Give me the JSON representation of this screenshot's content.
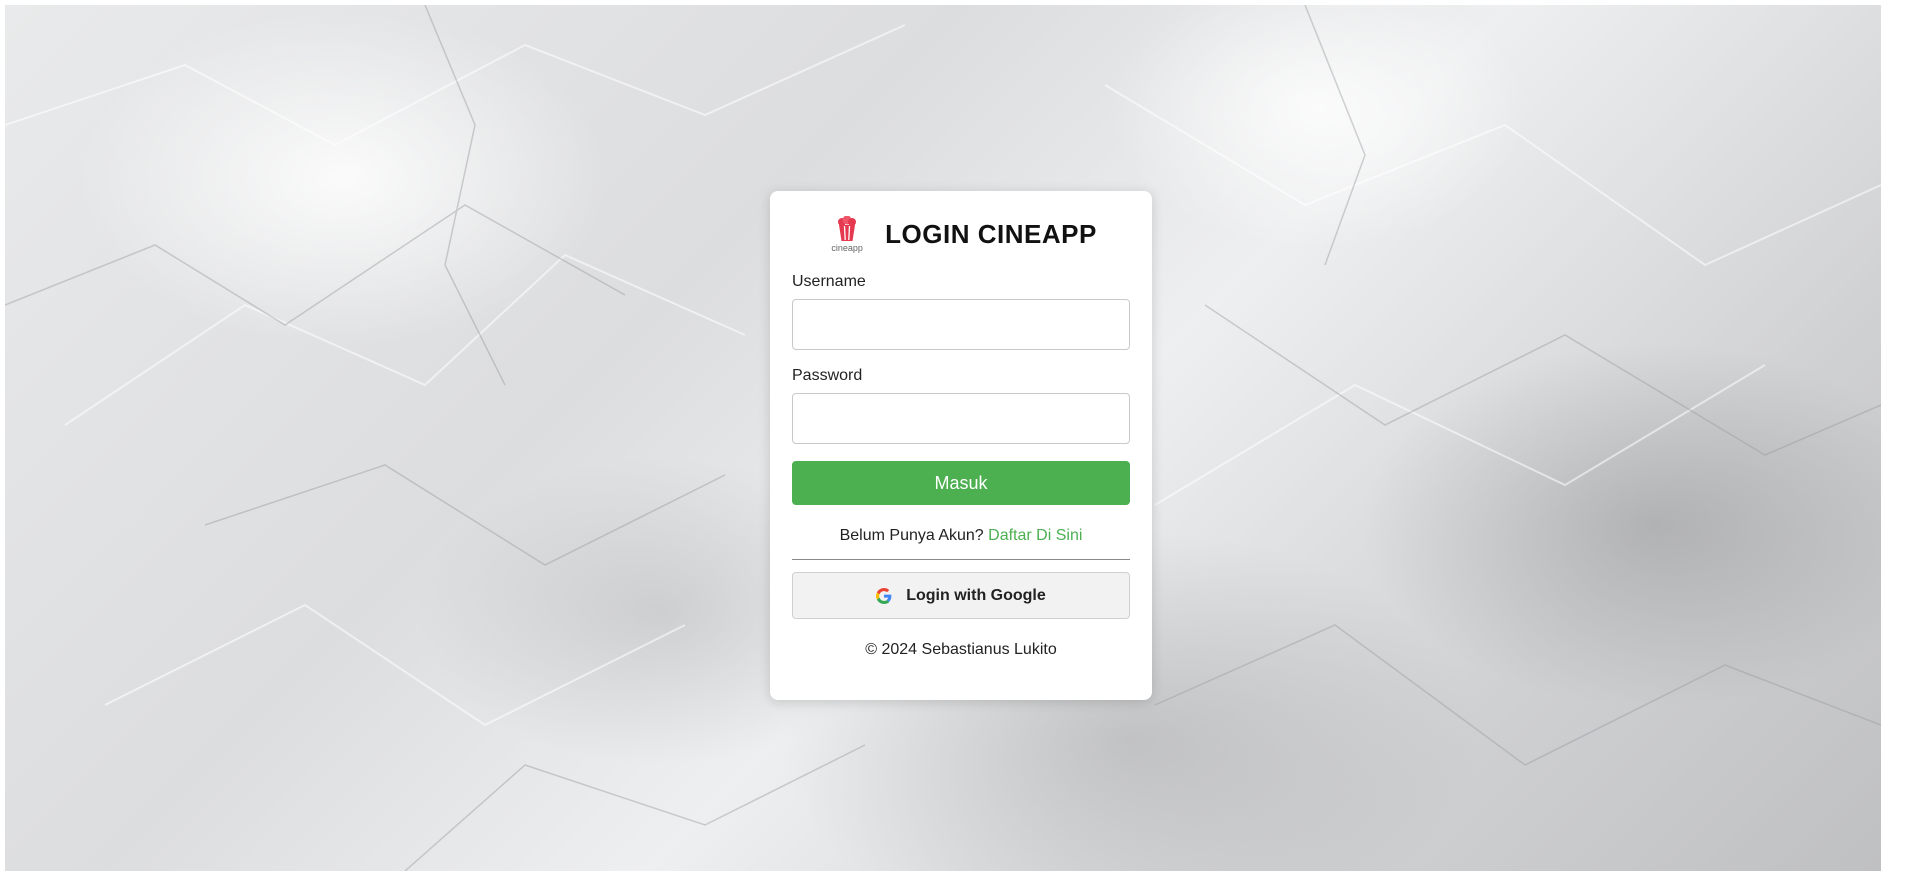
{
  "login": {
    "title": "LOGIN CINEAPP",
    "logo_text": "cineapp",
    "username_label": "Username",
    "username_value": "",
    "password_label": "Password",
    "password_value": "",
    "submit_label": "Masuk",
    "register_prompt": "Belum Punya Akun?",
    "register_link": "Daftar Di Sini",
    "google_label": "Login with Google",
    "footer": "© 2024 Sebastianus Lukito"
  },
  "colors": {
    "accent": "#4caf50",
    "logo": "#e53950"
  },
  "icons": {
    "logo": "popcorn-icon",
    "google": "google-icon"
  }
}
